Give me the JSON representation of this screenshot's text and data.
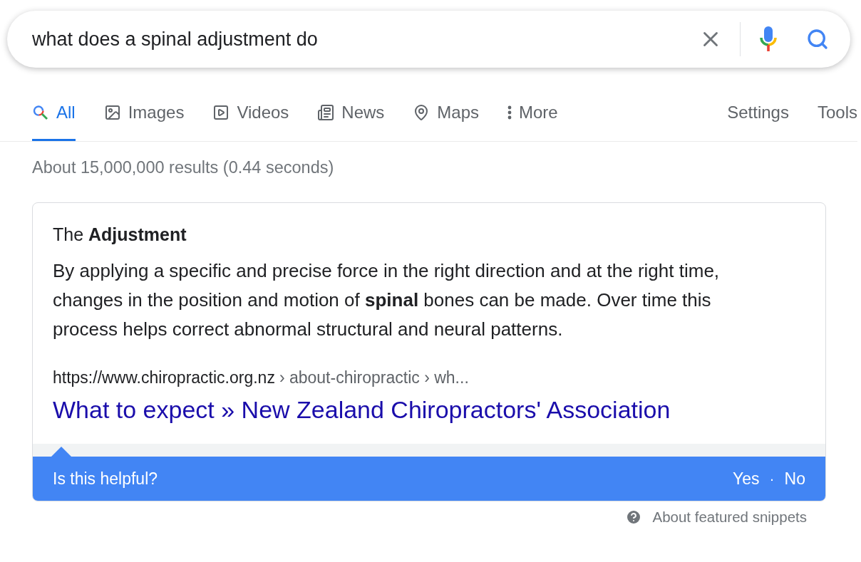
{
  "search": {
    "value": "what does a spinal adjustment do"
  },
  "tabs": [
    {
      "label": "All",
      "selected": true,
      "kind": "all"
    },
    {
      "label": "Images",
      "selected": false,
      "kind": "images"
    },
    {
      "label": "Videos",
      "selected": false,
      "kind": "videos"
    },
    {
      "label": "News",
      "selected": false,
      "kind": "news"
    },
    {
      "label": "Maps",
      "selected": false,
      "kind": "maps"
    },
    {
      "label": "More",
      "selected": false,
      "kind": "more"
    }
  ],
  "tools": [
    "Settings",
    "Tools"
  ],
  "result_stats": "About 15,000,000 results (0.44 seconds)",
  "snippet": {
    "title": "The **Adjustment**",
    "text": "By applying a specific and precise force in the right direction and at the right time, changes in the position and motion of **spinal** bones can be made. Over time this process helps correct abnormal structural and neural patterns.",
    "url": "https://www.chiropractic.org.nz",
    "breadcrumb": "› about-chiropractic › wh...",
    "link": "What to expect » New Zealand Chiropractors' Association"
  },
  "feedback": {
    "question": "Is this helpful?",
    "yes": "Yes",
    "separator": "·",
    "no": "No"
  },
  "about_snippets": "About featured snippets"
}
